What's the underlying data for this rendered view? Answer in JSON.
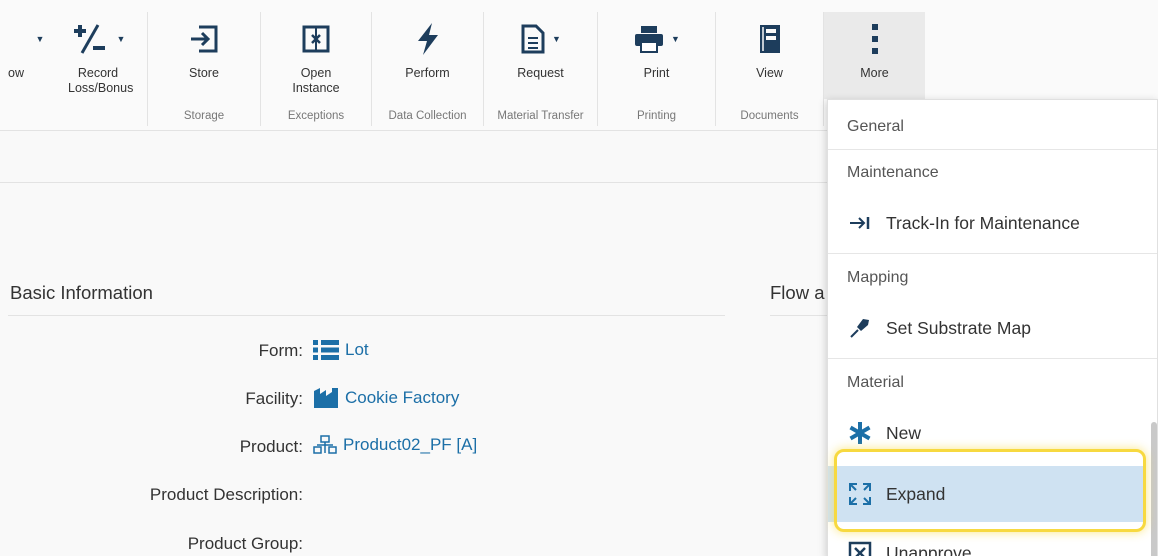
{
  "toolbar": {
    "partial_label": "ow",
    "record": "Record Loss/Bonus",
    "store": "Store",
    "open_instance": "Open Instance",
    "perform": "Perform",
    "request": "Request",
    "print": "Print",
    "view": "View",
    "more": "More",
    "groups": {
      "storage": "Storage",
      "exceptions": "Exceptions",
      "data_collection": "Data Collection",
      "material_transfer": "Material Transfer",
      "printing": "Printing",
      "documents": "Documents"
    }
  },
  "main": {
    "basic_info_title": "Basic Information",
    "flow_title_partial": "Flow a",
    "fields": [
      {
        "label": "Form:",
        "value": "Lot",
        "icon": "list-icon"
      },
      {
        "label": "Facility:",
        "value": "Cookie Factory",
        "icon": "factory-icon"
      },
      {
        "label": "Product:",
        "value": "Product02_PF [A]",
        "icon": "product-tree-icon"
      },
      {
        "label": "Product Description:",
        "value": ""
      },
      {
        "label": "Product Group:",
        "value": ""
      }
    ]
  },
  "dropdown": {
    "general": "General",
    "maintenance": "Maintenance",
    "track_in": "Track-In for Maintenance",
    "mapping": "Mapping",
    "set_substrate_map": "Set Substrate Map",
    "material": "Material",
    "new": "New",
    "expand": "Expand",
    "unapprove": "Unapprove"
  },
  "colors": {
    "brand_dark": "#1d3d5c",
    "link": "#1c6fa7",
    "highlight": "#cfe2f2",
    "focus": "#f7d940"
  }
}
